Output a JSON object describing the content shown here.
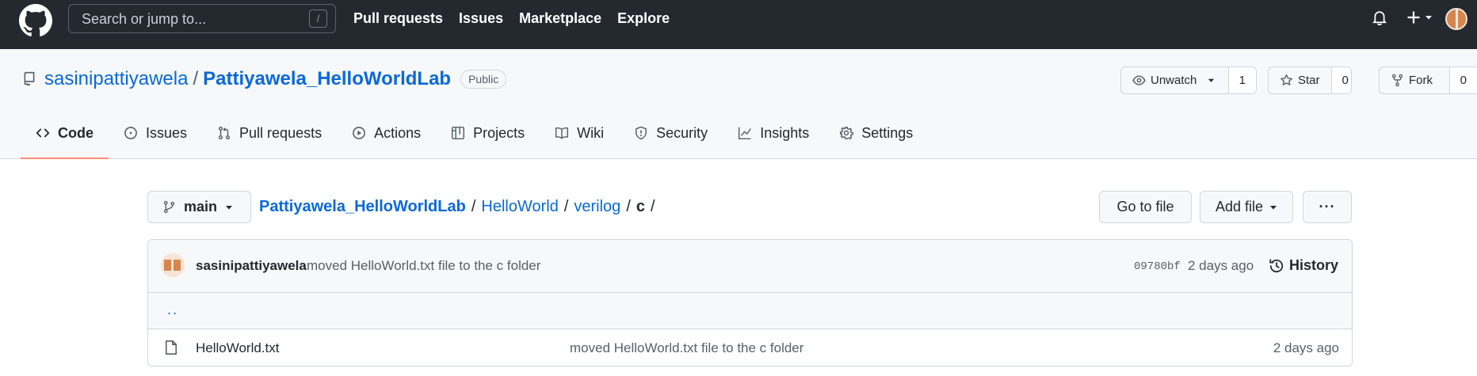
{
  "header": {
    "search_placeholder": "Search or jump to...",
    "search_shortcut": "/",
    "nav": [
      "Pull requests",
      "Issues",
      "Marketplace",
      "Explore"
    ]
  },
  "repo": {
    "owner": "sasinipattiyawela",
    "separator": "/",
    "name": "Pattiyawela_HelloWorldLab",
    "visibility": "Public",
    "watch": {
      "label": "Unwatch",
      "count": "1"
    },
    "star": {
      "label": "Star",
      "count": "0"
    },
    "fork": {
      "label": "Fork",
      "count": "0"
    }
  },
  "tabs": [
    {
      "label": "Code",
      "icon": "code-icon",
      "active": true
    },
    {
      "label": "Issues",
      "icon": "issue-opened-icon"
    },
    {
      "label": "Pull requests",
      "icon": "git-pull-request-icon"
    },
    {
      "label": "Actions",
      "icon": "play-icon"
    },
    {
      "label": "Projects",
      "icon": "table-icon"
    },
    {
      "label": "Wiki",
      "icon": "book-icon"
    },
    {
      "label": "Security",
      "icon": "shield-icon"
    },
    {
      "label": "Insights",
      "icon": "graph-icon"
    },
    {
      "label": "Settings",
      "icon": "gear-icon"
    }
  ],
  "file_nav": {
    "branch": "main",
    "breadcrumb": {
      "root": "Pattiyawela_HelloWorldLab",
      "path": [
        "HelloWorld",
        "verilog"
      ],
      "current": "c",
      "sep": "/"
    },
    "go_to_file": "Go to file",
    "add_file": "Add file",
    "more": "···"
  },
  "commit": {
    "author": "sasinipattiyawela",
    "message": "moved HelloWorld.txt file to the c folder",
    "sha": "09780bf",
    "age": "2 days ago",
    "history": "History"
  },
  "parent_link": "..",
  "files": [
    {
      "name": "HelloWorld.txt",
      "message": "moved HelloWorld.txt file to the c folder",
      "age": "2 days ago"
    }
  ],
  "colors": {
    "header_bg": "#24292f",
    "link": "#0969da",
    "active_tab_underline": "#fd8c73",
    "avatar": "#d5864f"
  }
}
